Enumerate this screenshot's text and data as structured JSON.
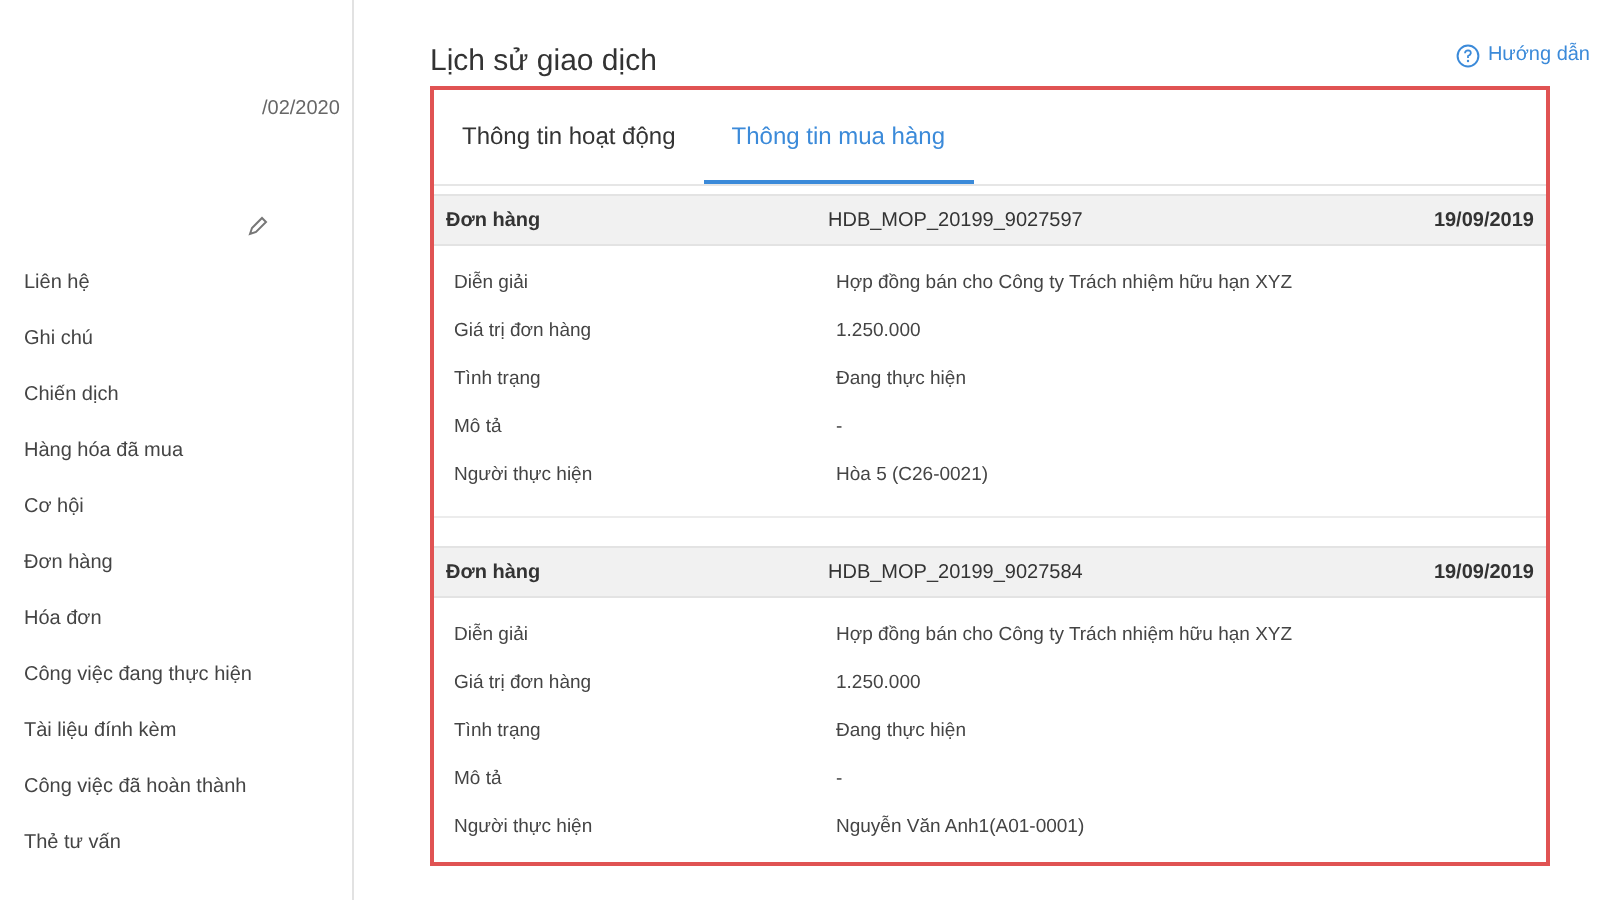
{
  "sidebar": {
    "date_fragment": "/02/2020",
    "items": [
      "Liên hệ",
      "Ghi chú",
      "Chiến dịch",
      "Hàng hóa đã mua",
      "Cơ hội",
      "Đơn hàng",
      "Hóa đơn",
      "Công việc đang thực hiện",
      "Tài liệu đính kèm",
      "Công việc đã hoàn thành",
      "Thẻ tư vấn"
    ]
  },
  "page": {
    "title": "Lịch sử giao dịch",
    "help_link": "Hướng dẫn"
  },
  "tabs": [
    {
      "label": "Thông tin hoạt động",
      "selected": false
    },
    {
      "label": "Thông tin mua hàng",
      "selected": true
    }
  ],
  "orders": [
    {
      "label": "Đơn hàng",
      "code": "HDB_MOP_20199_9027597",
      "date": "19/09/2019",
      "fields": [
        {
          "label": "Diễn giải",
          "value": "Hợp đồng bán cho Công ty Trách nhiệm hữu hạn XYZ"
        },
        {
          "label": "Giá trị đơn hàng",
          "value": "1.250.000"
        },
        {
          "label": "Tình trạng",
          "value": "Đang thực hiện"
        },
        {
          "label": "Mô tả",
          "value": "-"
        },
        {
          "label": "Người thực hiện",
          "value": "Hòa 5 (C26-0021)"
        }
      ]
    },
    {
      "label": "Đơn hàng",
      "code": "HDB_MOP_20199_9027584",
      "date": "19/09/2019",
      "fields": [
        {
          "label": "Diễn giải",
          "value": "Hợp đồng bán cho Công ty Trách nhiệm hữu hạn XYZ"
        },
        {
          "label": "Giá trị đơn hàng",
          "value": "1.250.000"
        },
        {
          "label": "Tình trạng",
          "value": "Đang thực hiện"
        },
        {
          "label": "Mô tả",
          "value": "-"
        },
        {
          "label": "Người thực hiện",
          "value": "Nguyễn Văn Anh1(A01-0001)"
        }
      ]
    }
  ]
}
